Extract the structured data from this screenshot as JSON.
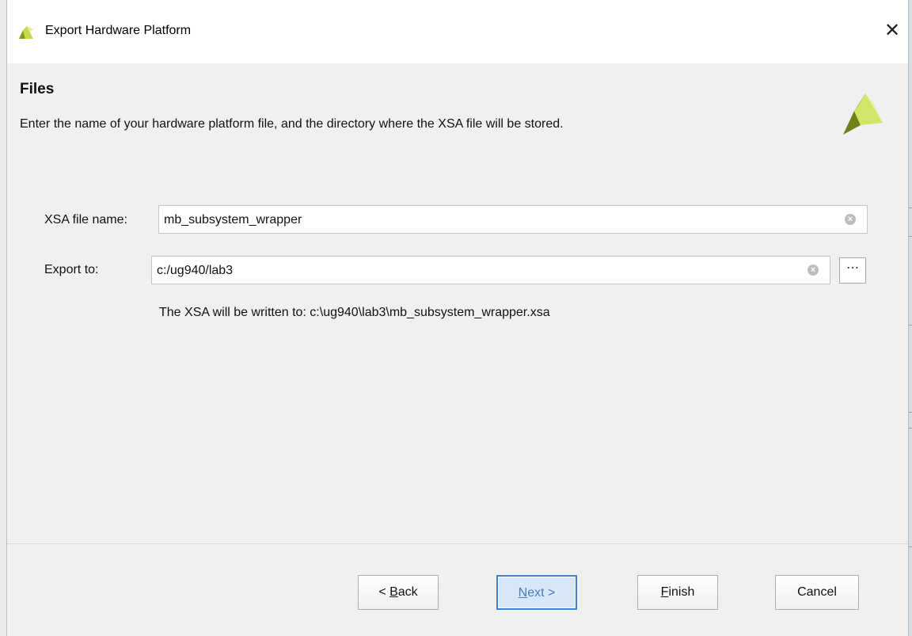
{
  "window": {
    "title": "Export Hardware Platform",
    "close_label": "✕"
  },
  "header": {
    "title": "Files",
    "description": "Enter the name of your hardware platform file, and the directory where the XSA file will be stored."
  },
  "form": {
    "xsa_name_label": "XSA file name:",
    "xsa_name_value": "mb_subsystem_wrapper",
    "export_to_label": "Export to:",
    "export_to_value": "c:/ug940/lab3",
    "browse_label": "⋯",
    "clear_icon": "×",
    "output_path_text": "The XSA will be written to: c:\\ug940\\lab3\\mb_subsystem_wrapper.xsa"
  },
  "buttons": {
    "back_prefix": "< ",
    "back_mnemonic": "B",
    "back_rest": "ack",
    "next_mnemonic": "N",
    "next_rest": "ext >",
    "finish_mnemonic": "F",
    "finish_rest": "inish",
    "cancel": "Cancel"
  },
  "colors": {
    "logo_dark": "#8a9a1f",
    "logo_light": "#d6e86a",
    "next_border": "#3d7fd5"
  }
}
